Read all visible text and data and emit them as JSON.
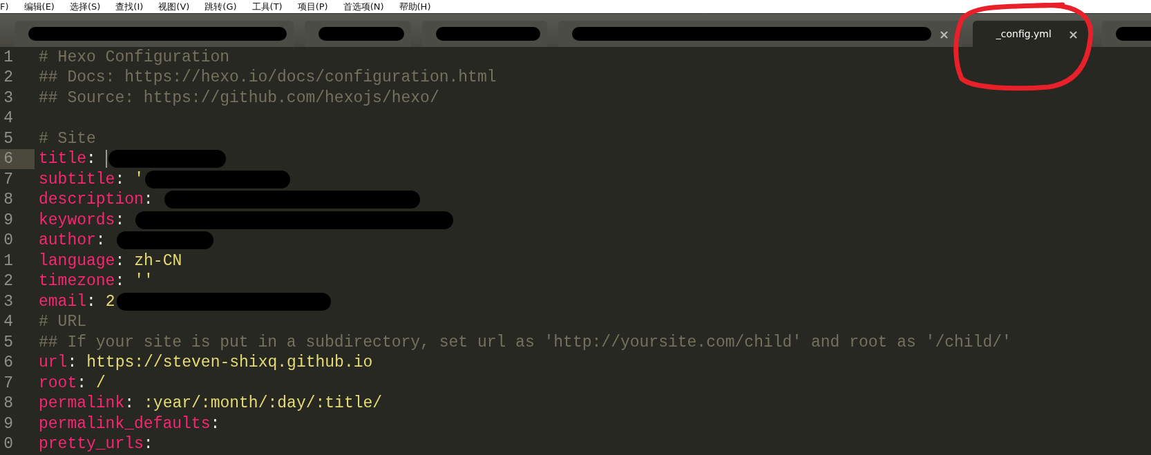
{
  "menu": [
    "F)",
    "编辑(E)",
    "选择(S)",
    "查找(I)",
    "视图(V)",
    "跳转(G)",
    "工具(T)",
    "项目(P)",
    "首选项(N)",
    "帮助(H)"
  ],
  "tabs": [
    {
      "selected": false,
      "redacted": true,
      "close_visible": false
    },
    {
      "selected": false,
      "redacted": true,
      "close_visible": false
    },
    {
      "selected": false,
      "redacted": true,
      "close_visible": false
    },
    {
      "selected": false,
      "redacted": true,
      "close_visible": true,
      "close": "×"
    },
    {
      "label": "_config.yml",
      "selected": true,
      "redacted": false,
      "close_visible": true,
      "close": "×"
    },
    {
      "selected": false,
      "redacted": true,
      "close_visible": false
    }
  ],
  "lines": [
    {
      "num": "1",
      "kind": "comment",
      "text": "# Hexo Configuration",
      "current": false,
      "redacted": false
    },
    {
      "num": "2",
      "kind": "comment",
      "text": "## Docs: https://hexo.io/docs/configuration.html",
      "current": false,
      "redacted": false
    },
    {
      "num": "3",
      "kind": "comment",
      "text": "## Source: https://github.com/hexojs/hexo/",
      "current": false,
      "redacted": false
    },
    {
      "num": "4",
      "kind": "blank",
      "current": false,
      "redacted": false
    },
    {
      "num": "5",
      "kind": "comment",
      "text": "# Site",
      "current": false,
      "redacted": false
    },
    {
      "num": "6",
      "kind": "pair",
      "key": "title",
      "sep": ":",
      "current": true,
      "redacted": true
    },
    {
      "num": "7",
      "kind": "pair",
      "key": "subtitle",
      "sep": ":",
      "value": "'",
      "current": false,
      "redacted": true
    },
    {
      "num": "8",
      "kind": "pair",
      "key": "description",
      "sep": ":",
      "current": false,
      "redacted": true
    },
    {
      "num": "9",
      "kind": "pair",
      "key": "keywords",
      "sep": ":",
      "current": false,
      "redacted": true
    },
    {
      "num": "0",
      "kind": "pair",
      "key": "author",
      "sep": ":",
      "current": false,
      "redacted": true
    },
    {
      "num": "1",
      "kind": "pair",
      "key": "language",
      "sep": ":",
      "value": "zh-CN",
      "current": false,
      "redacted": false
    },
    {
      "num": "2",
      "kind": "pair",
      "key": "timezone",
      "sep": ":",
      "value": "''",
      "current": false,
      "redacted": false
    },
    {
      "num": "3",
      "kind": "pair",
      "key": "email",
      "sep": ":",
      "value": "2",
      "current": false,
      "redacted": true
    },
    {
      "num": "4",
      "kind": "comment",
      "text": "# URL",
      "current": false,
      "redacted": false
    },
    {
      "num": "5",
      "kind": "comment",
      "text": "## If your site is put in a subdirectory, set url as 'http://yoursite.com/child' and root as '/child/'",
      "current": false,
      "redacted": false
    },
    {
      "num": "6",
      "kind": "pair",
      "key": "url",
      "sep": ":",
      "value": "https://steven-shixq.github.io",
      "current": false,
      "redacted": false
    },
    {
      "num": "7",
      "kind": "pair",
      "key": "root",
      "sep": ":",
      "value": "/",
      "current": false,
      "redacted": false
    },
    {
      "num": "8",
      "kind": "pair",
      "key": "permalink",
      "sep": ":",
      "value": ":year/:month/:day/:title/",
      "current": false,
      "redacted": false
    },
    {
      "num": "9",
      "kind": "pair",
      "key": "permalink_defaults",
      "sep": ":",
      "current": false,
      "redacted": false
    },
    {
      "num": "0",
      "kind": "pair",
      "key": "pretty_urls",
      "sep": ":",
      "current": false,
      "redacted": false
    }
  ]
}
